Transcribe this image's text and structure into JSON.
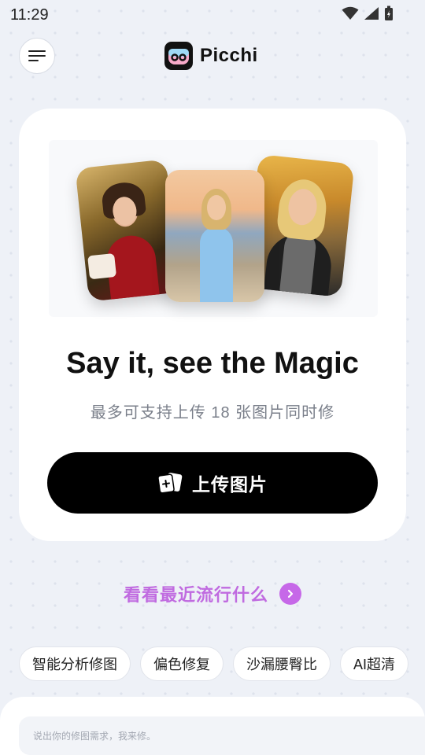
{
  "status_bar": {
    "time": "11:29"
  },
  "header": {
    "app_name": "Picchi"
  },
  "card": {
    "headline": "Say it, see the Magic",
    "subtitle": "最多可支持上传 18 张图片同时修",
    "upload_label": "上传图片"
  },
  "trending": {
    "label": "看看最近流行什么"
  },
  "chips": [
    "智能分析修图",
    "偏色修复",
    "沙漏腰臀比",
    "AI超清"
  ],
  "prompt": {
    "placeholder": "说出你的修图需求，我来修。"
  },
  "colors": {
    "accent": "#c668e8",
    "button": "#000000",
    "background": "#eef1f7"
  }
}
